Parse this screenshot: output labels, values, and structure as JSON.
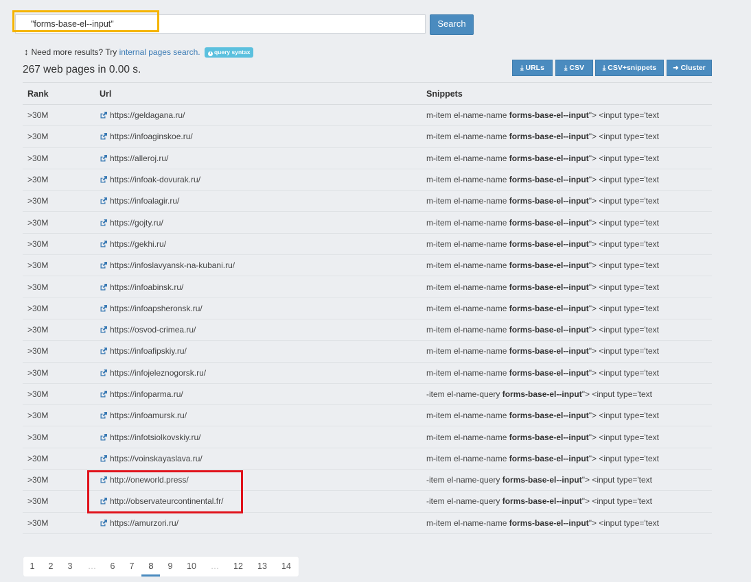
{
  "search": {
    "value": "\"forms-base-el--input\"",
    "button": "Search"
  },
  "hint": {
    "prefix": "Need more results? Try",
    "link": "internal pages search.",
    "badge": "query syntax"
  },
  "result_count": "267 web pages in 0.00 s.",
  "export_buttons": {
    "urls": "URLs",
    "csv": "CSV",
    "csv_snippets": "CSV+snippets",
    "cluster": "Cluster"
  },
  "table": {
    "headers": {
      "rank": "Rank",
      "url": "Url",
      "snippets": "Snippets"
    },
    "rows": [
      {
        "rank": ">30M",
        "url": "https://geldagana.ru/",
        "pre": "m-item el-name-name ",
        "bold": "forms-base-el--input",
        "post": "\"> <input type='text"
      },
      {
        "rank": ">30M",
        "url": "https://infoaginskoe.ru/",
        "pre": "m-item el-name-name ",
        "bold": "forms-base-el--input",
        "post": "\"> <input type='text"
      },
      {
        "rank": ">30M",
        "url": "https://alleroj.ru/",
        "pre": "m-item el-name-name ",
        "bold": "forms-base-el--input",
        "post": "\"> <input type='text"
      },
      {
        "rank": ">30M",
        "url": "https://infoak-dovurak.ru/",
        "pre": "m-item el-name-name ",
        "bold": "forms-base-el--input",
        "post": "\"> <input type='text"
      },
      {
        "rank": ">30M",
        "url": "https://infoalagir.ru/",
        "pre": "m-item el-name-name ",
        "bold": "forms-base-el--input",
        "post": "\"> <input type='text"
      },
      {
        "rank": ">30M",
        "url": "https://gojty.ru/",
        "pre": "m-item el-name-name ",
        "bold": "forms-base-el--input",
        "post": "\"> <input type='text"
      },
      {
        "rank": ">30M",
        "url": "https://gekhi.ru/",
        "pre": "m-item el-name-name ",
        "bold": "forms-base-el--input",
        "post": "\"> <input type='text"
      },
      {
        "rank": ">30M",
        "url": "https://infoslavyansk-na-kubani.ru/",
        "pre": "m-item el-name-name ",
        "bold": "forms-base-el--input",
        "post": "\"> <input type='text"
      },
      {
        "rank": ">30M",
        "url": "https://infoabinsk.ru/",
        "pre": "m-item el-name-name ",
        "bold": "forms-base-el--input",
        "post": "\"> <input type='text"
      },
      {
        "rank": ">30M",
        "url": "https://infoapsheronsk.ru/",
        "pre": "m-item el-name-name ",
        "bold": "forms-base-el--input",
        "post": "\"> <input type='text"
      },
      {
        "rank": ">30M",
        "url": "https://osvod-crimea.ru/",
        "pre": "m-item el-name-name ",
        "bold": "forms-base-el--input",
        "post": "\"> <input type='text"
      },
      {
        "rank": ">30M",
        "url": "https://infoafipskiy.ru/",
        "pre": "m-item el-name-name ",
        "bold": "forms-base-el--input",
        "post": "\"> <input type='text"
      },
      {
        "rank": ">30M",
        "url": "https://infojeleznogorsk.ru/",
        "pre": "m-item el-name-name ",
        "bold": "forms-base-el--input",
        "post": "\"> <input type='text"
      },
      {
        "rank": ">30M",
        "url": "https://infoparma.ru/",
        "pre": "-item el-name-query ",
        "bold": "forms-base-el--input",
        "post": "\"> <input type='text"
      },
      {
        "rank": ">30M",
        "url": "https://infoamursk.ru/",
        "pre": "m-item el-name-name ",
        "bold": "forms-base-el--input",
        "post": "\"> <input type='text"
      },
      {
        "rank": ">30M",
        "url": "https://infotsiolkovskiy.ru/",
        "pre": "m-item el-name-name ",
        "bold": "forms-base-el--input",
        "post": "\"> <input type='text"
      },
      {
        "rank": ">30M",
        "url": "https://voinskayaslava.ru/",
        "pre": "m-item el-name-name ",
        "bold": "forms-base-el--input",
        "post": "\"> <input type='text"
      },
      {
        "rank": ">30M",
        "url": "http://oneworld.press/",
        "pre": "-item el-name-query ",
        "bold": "forms-base-el--input",
        "post": "\"> <input type='text"
      },
      {
        "rank": ">30M",
        "url": "http://observateurcontinental.fr/",
        "pre": "-item el-name-query ",
        "bold": "forms-base-el--input",
        "post": "\"> <input type='text"
      },
      {
        "rank": ">30M",
        "url": "https://amurzori.ru/",
        "pre": "m-item el-name-name ",
        "bold": "forms-base-el--input",
        "post": "\"> <input type='text"
      }
    ]
  },
  "pagination": {
    "current": "8",
    "items": [
      "1",
      "2",
      "3",
      "…",
      "6",
      "7",
      "8",
      "9",
      "10",
      "…",
      "12",
      "13",
      "14"
    ]
  },
  "colors": {
    "primary": "#4a8bbf",
    "highlight_yellow": "#f5b400",
    "highlight_red": "#e0121b",
    "link": "#3a7ab4"
  }
}
